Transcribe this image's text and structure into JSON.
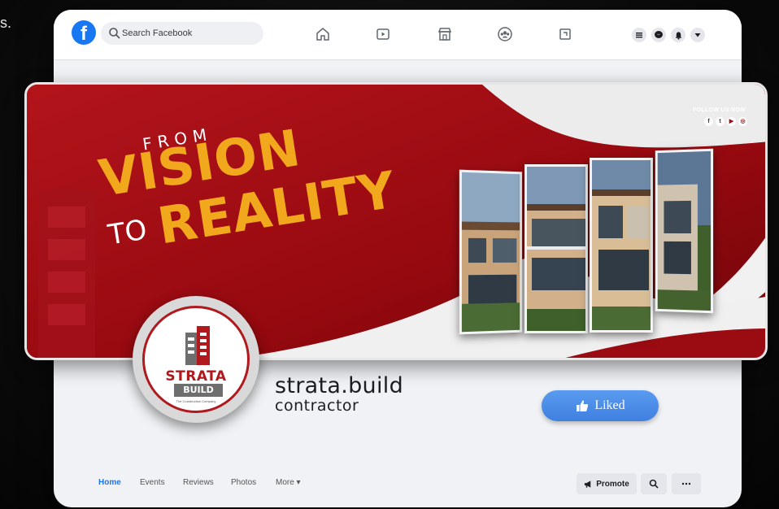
{
  "corner_text": "s.",
  "search": {
    "placeholder": "Search Facebook"
  },
  "nav_icons": [
    "home-icon",
    "watch-icon",
    "marketplace-icon",
    "groups-icon",
    "gaming-icon"
  ],
  "right_icons": [
    "menu-icon",
    "messenger-icon",
    "notifications-icon",
    "account-icon"
  ],
  "cover": {
    "from": "FROM",
    "vision": "VISION",
    "to": "TO",
    "reality": "REALITY",
    "follow": "FOLLOW US NOW",
    "socials": [
      "facebook-icon",
      "twitter-icon",
      "youtube-icon",
      "instagram-icon"
    ]
  },
  "logo": {
    "strata": "STRATA",
    "build": "BUILD",
    "tagline": "The Construction Company"
  },
  "profile": {
    "name": "strata.build",
    "category": "contractor",
    "liked_label": "Liked"
  },
  "tabs": [
    {
      "label": "Home",
      "active": true
    },
    {
      "label": "Events",
      "active": false
    },
    {
      "label": "Reviews",
      "active": false
    },
    {
      "label": "Photos",
      "active": false
    },
    {
      "label": "More ▾",
      "active": false
    }
  ],
  "actions": {
    "promote": "Promote"
  },
  "colors": {
    "brand_red": "#9a0c12",
    "accent_gold": "#f2a81d",
    "facebook_blue": "#1877f2"
  }
}
